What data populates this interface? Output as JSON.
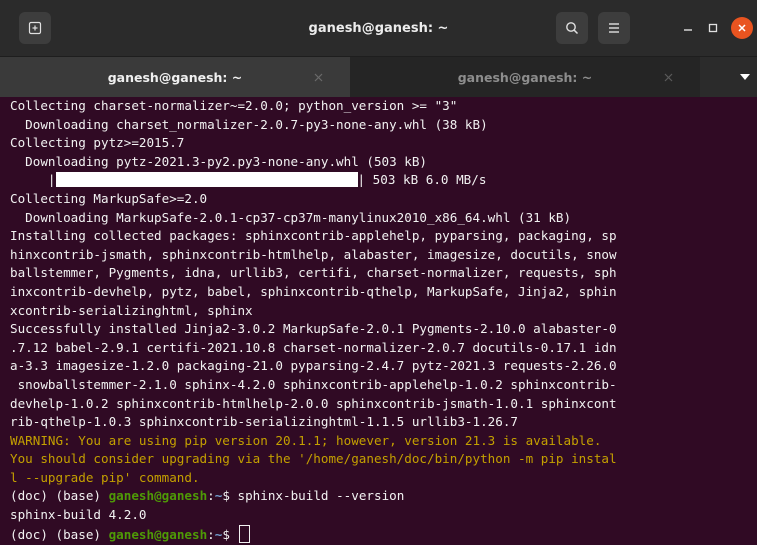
{
  "window": {
    "title": "ganesh@ganesh: ~"
  },
  "colors": {
    "terminal_bg": "#300a24",
    "warning": "#c4a000",
    "prompt_user": "#4e9a06",
    "prompt_path": "#729fcf",
    "close_button": "#e95420"
  },
  "tabs": [
    {
      "label": "ganesh@ganesh: ~",
      "active": true
    },
    {
      "label": "ganesh@ganesh: ~",
      "active": false
    }
  ],
  "icons": {
    "new_tab": "new-tab-icon",
    "search": "search-icon",
    "menu": "hamburger-menu-icon",
    "minimize": "minimize-icon",
    "maximize": "maximize-icon",
    "close": "close-icon",
    "tab_close": "close-icon",
    "tab_list": "chevron-down-icon"
  },
  "terminal": {
    "lines": [
      "Collecting charset-normalizer~=2.0.0; python_version >= \"3\"",
      "  Downloading charset_normalizer-2.0.7-py3-none-any.whl (38 kB)",
      "Collecting pytz>=2015.7",
      "  Downloading pytz-2021.3-py2.py3-none-any.whl (503 kB)"
    ],
    "progress": {
      "prefix": "     |",
      "fraction": 1.0,
      "suffix": "| 503 kB 6.0 MB/s"
    },
    "lines_after": [
      "Collecting MarkupSafe>=2.0",
      "  Downloading MarkupSafe-2.0.1-cp37-cp37m-manylinux2010_x86_64.whl (31 kB)",
      "Installing collected packages: sphinxcontrib-applehelp, pyparsing, packaging, sp",
      "hinxcontrib-jsmath, sphinxcontrib-htmlhelp, alabaster, imagesize, docutils, snow",
      "ballstemmer, Pygments, idna, urllib3, certifi, charset-normalizer, requests, sph",
      "inxcontrib-devhelp, pytz, babel, sphinxcontrib-qthelp, MarkupSafe, Jinja2, sphin",
      "xcontrib-serializinghtml, sphinx",
      "Successfully installed Jinja2-3.0.2 MarkupSafe-2.0.1 Pygments-2.10.0 alabaster-0",
      ".7.12 babel-2.9.1 certifi-2021.10.8 charset-normalizer-2.0.7 docutils-0.17.1 idn",
      "a-3.3 imagesize-1.2.0 packaging-21.0 pyparsing-2.4.7 pytz-2021.3 requests-2.26.0",
      " snowballstemmer-2.1.0 sphinx-4.2.0 sphinxcontrib-applehelp-1.0.2 sphinxcontrib-",
      "devhelp-1.0.2 sphinxcontrib-htmlhelp-2.0.0 sphinxcontrib-jsmath-1.0.1 sphinxcont",
      "rib-qthelp-1.0.3 sphinxcontrib-serializinghtml-1.1.5 urllib3-1.26.7"
    ],
    "warning_lines": [
      "WARNING: You are using pip version 20.1.1; however, version 21.3 is available.",
      "You should consider upgrading via the '/home/ganesh/doc/bin/python -m pip instal",
      "l --upgrade pip' command."
    ],
    "prompt1": {
      "prefix": "(doc) (base) ",
      "user_host": "ganesh@ganesh",
      "colon": ":",
      "path": "~",
      "symbol": "$ ",
      "command": "sphinx-build --version"
    },
    "output": "sphinx-build 4.2.0",
    "prompt2": {
      "prefix": "(doc) (base) ",
      "user_host": "ganesh@ganesh",
      "colon": ":",
      "path": "~",
      "symbol": "$ "
    }
  }
}
